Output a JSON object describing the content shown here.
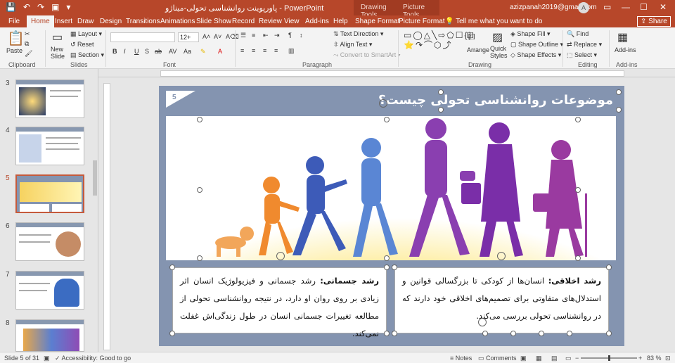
{
  "titlebar": {
    "qat": [
      "💾",
      "↶",
      "↷",
      "▣",
      "▾"
    ],
    "title": "پاورپوینت روانشناسی تحولی-میناژو - PowerPoint",
    "context_headers": [
      "Drawing Tools",
      "Picture Tools"
    ],
    "account": "azizpanah2019@gmail.com",
    "avatar": "A",
    "window_buttons": [
      "▭",
      "—",
      "☐",
      "✕"
    ]
  },
  "tabs": [
    "File",
    "Home",
    "Insert",
    "Draw",
    "Design",
    "Transitions",
    "Animations",
    "Slide Show",
    "Record",
    "Review",
    "View",
    "Add-ins",
    "Help",
    "Shape Format",
    "Picture Format"
  ],
  "active_tab": "Home",
  "tell_me": "Tell me what you want to do",
  "share": "Share",
  "ribbon": {
    "clipboard": {
      "paste": "Paste",
      "group": "Clipboard"
    },
    "slides": {
      "new_slide": "New Slide",
      "layout": "Layout",
      "reset": "Reset",
      "section": "Section",
      "group": "Slides"
    },
    "font": {
      "size": "12+",
      "group": "Font"
    },
    "paragraph": {
      "text_direction": "Text Direction",
      "align_text": "Align Text",
      "smartart": "Convert to SmartArt",
      "group": "Paragraph"
    },
    "drawing": {
      "arrange": "Arrange",
      "quick_styles": "Quick Styles",
      "shape_fill": "Shape Fill",
      "shape_outline": "Shape Outline",
      "shape_effects": "Shape Effects",
      "group": "Drawing"
    },
    "editing": {
      "find": "Find",
      "replace": "Replace",
      "select": "Select",
      "group": "Editing"
    },
    "addins": {
      "label": "Add-ins",
      "group": "Add-ins"
    }
  },
  "thumbnails": [
    {
      "num": "3",
      "selected": false
    },
    {
      "num": "4",
      "selected": false
    },
    {
      "num": "5",
      "selected": true
    },
    {
      "num": "6",
      "selected": false
    },
    {
      "num": "7",
      "selected": false
    },
    {
      "num": "8",
      "selected": false
    }
  ],
  "slide": {
    "number": "5",
    "title": "موضوعات روانشناسی تحولی چیست؟",
    "box_right": {
      "bold": "رشد اخلاقی:",
      "text": " انسان‌ها از کودکی تا بزرگسالی قوانین و استدلال‌های متفاوتی برای تصمیم‌های اخلاقی خود دارند که در روانشناسی تحولی بررسی می‌کند."
    },
    "box_left": {
      "bold": "رشد جسمانی:",
      "text": " رشد جسمانی و فیزیولوژیک انسان اثر زیادی بر روی روان او دارد، در نتیجه روانشناسی تحولی از مطالعه تغییرات جسمانی انسان در طول زندگی‌اش غفلت نمی‌کند."
    }
  },
  "status": {
    "slide_of": "Slide 5 of 31",
    "accessibility": "Accessibility: Good to go",
    "notes": "Notes",
    "comments": "Comments",
    "zoom": "83 %"
  },
  "colors": {
    "accent": "#b7472a",
    "slide_bg": "#8494b0",
    "figures": [
      "#f2a65a",
      "#f08a2e",
      "#3d5bb8",
      "#5a86d4",
      "#8a3fb0",
      "#7a2ea8",
      "#9a3aa0"
    ]
  }
}
